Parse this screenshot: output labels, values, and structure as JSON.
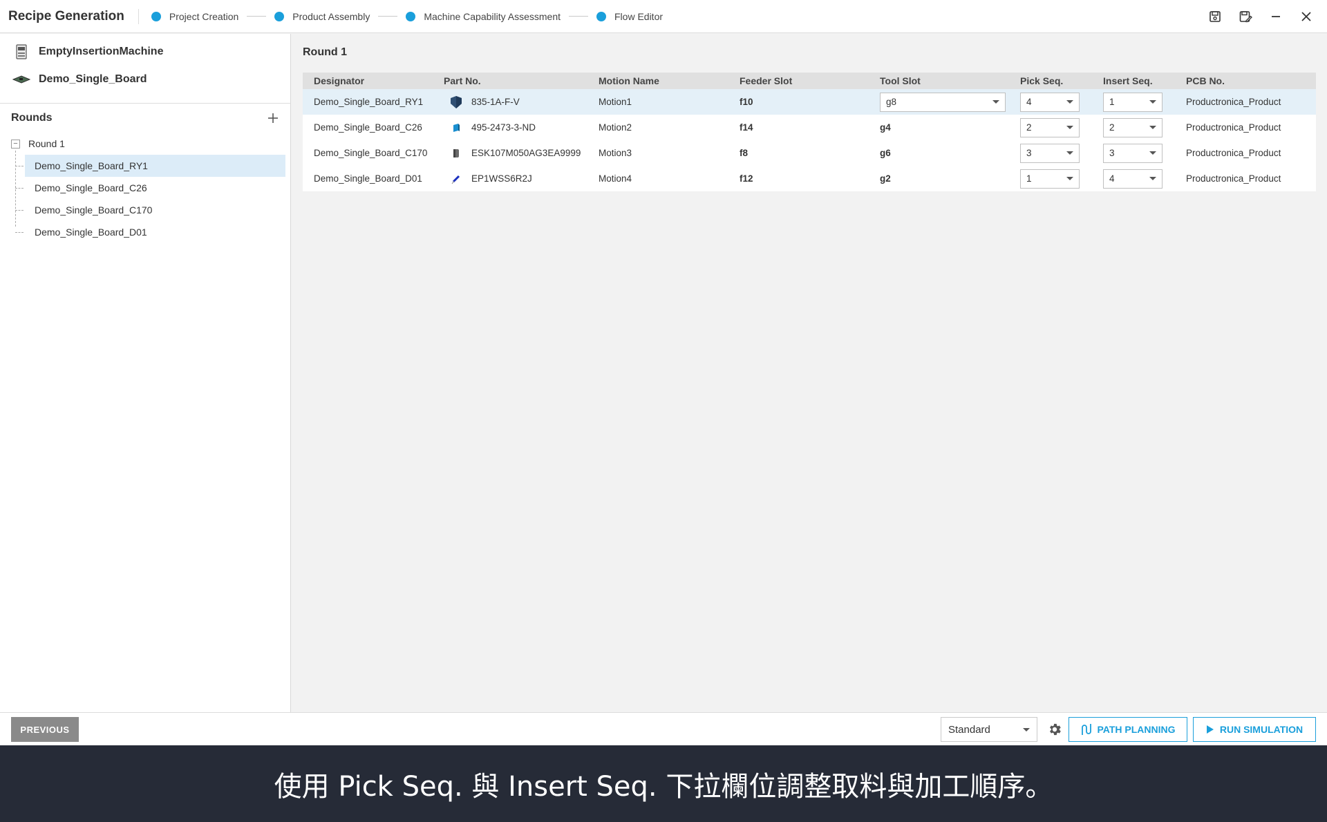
{
  "app": {
    "title": "Recipe Generation",
    "steps": [
      {
        "label": "Project Creation"
      },
      {
        "label": "Product Assembly"
      },
      {
        "label": "Machine Capability Assessment"
      },
      {
        "label": "Flow Editor"
      }
    ],
    "accent_color": "#1a9fdb"
  },
  "left_panel": {
    "machine_name": "EmptyInsertionMachine",
    "board_name": "Demo_Single_Board",
    "rounds_title": "Rounds",
    "tree": {
      "round_label": "Round 1",
      "items": [
        {
          "label": "Demo_Single_Board_RY1",
          "selected": true
        },
        {
          "label": "Demo_Single_Board_C26",
          "selected": false
        },
        {
          "label": "Demo_Single_Board_C170",
          "selected": false
        },
        {
          "label": "Demo_Single_Board_D01",
          "selected": false
        }
      ]
    }
  },
  "main": {
    "round_title": "Round 1",
    "columns": [
      "Designator",
      "Part No.",
      "Motion Name",
      "Feeder Slot",
      "Tool Slot",
      "Pick Seq.",
      "Insert Seq.",
      "PCB No."
    ],
    "rows": [
      {
        "designator": "Demo_Single_Board_RY1",
        "part_no": "835-1A-F-V",
        "motion": "Motion1",
        "feeder": "f10",
        "tool": "g8",
        "pick": "4",
        "insert": "1",
        "pcb": "Productronica_Product"
      },
      {
        "designator": "Demo_Single_Board_C26",
        "part_no": "495-2473-3-ND",
        "motion": "Motion2",
        "feeder": "f14",
        "tool": "g4",
        "pick": "2",
        "insert": "2",
        "pcb": "Productronica_Product"
      },
      {
        "designator": "Demo_Single_Board_C170",
        "part_no": "ESK107M050AG3EA9999",
        "motion": "Motion3",
        "feeder": "f8",
        "tool": "g6",
        "pick": "3",
        "insert": "3",
        "pcb": "Productronica_Product"
      },
      {
        "designator": "Demo_Single_Board_D01",
        "part_no": "EP1WSS6R2J",
        "motion": "Motion4",
        "feeder": "f12",
        "tool": "g2",
        "pick": "1",
        "insert": "4",
        "pcb": "Productronica_Product"
      }
    ]
  },
  "bottom": {
    "previous_label": "PREVIOUS",
    "mode_value": "Standard",
    "path_planning_label": "PATH PLANNING",
    "run_simulation_label": "RUN SIMULATION"
  },
  "caption": "使用 Pick Seq. 與 Insert Seq. 下拉欄位調整取料與加工順序。"
}
